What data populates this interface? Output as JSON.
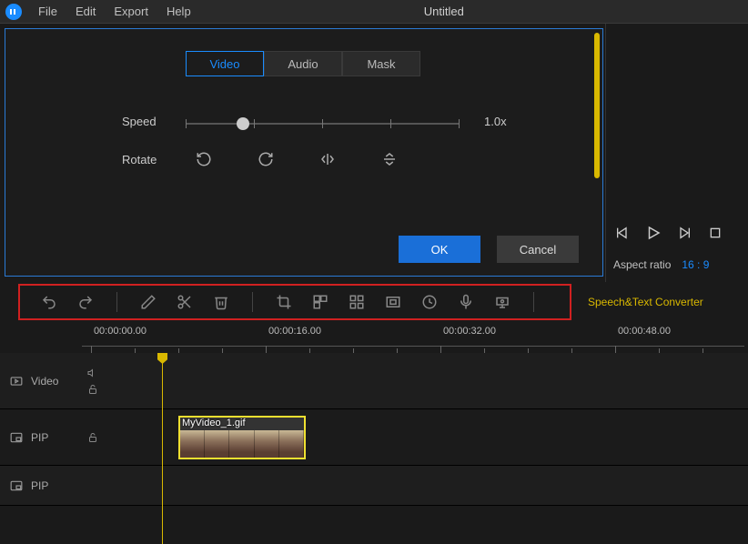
{
  "menu": {
    "file": "File",
    "edit": "Edit",
    "export": "Export",
    "help": "Help"
  },
  "title": "Untitled",
  "tabs": {
    "video": "Video",
    "audio": "Audio",
    "mask": "Mask"
  },
  "props": {
    "speed_label": "Speed",
    "speed_value": "1.0x",
    "rotate_label": "Rotate"
  },
  "dialog": {
    "ok": "OK",
    "cancel": "Cancel"
  },
  "aspect": {
    "label": "Aspect ratio",
    "value": "16 : 9"
  },
  "toolbar_link": "Speech&Text Converter",
  "ruler": {
    "marks": [
      "00:00:00.00",
      "00:00:16.00",
      "00:00:32.00",
      "00:00:48.00"
    ]
  },
  "tracks": {
    "video": "Video",
    "pip1": "PIP",
    "pip2": "PIP"
  },
  "clip": {
    "name": "MyVideo_1.gif"
  }
}
